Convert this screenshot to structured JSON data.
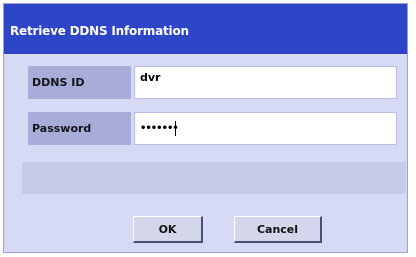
{
  "dialog": {
    "title": "Retrieve DDNS Information",
    "fields": {
      "ddns_id_label": "DDNS ID",
      "ddns_id_value": "dvr",
      "password_label": "Password",
      "password_value": "•••••••"
    },
    "buttons": {
      "ok": "OK",
      "cancel": "Cancel"
    }
  },
  "colors": {
    "titlebar": "#2f45c8",
    "dialog_bg": "#d6daf5",
    "label_bg": "#a7acd9"
  }
}
